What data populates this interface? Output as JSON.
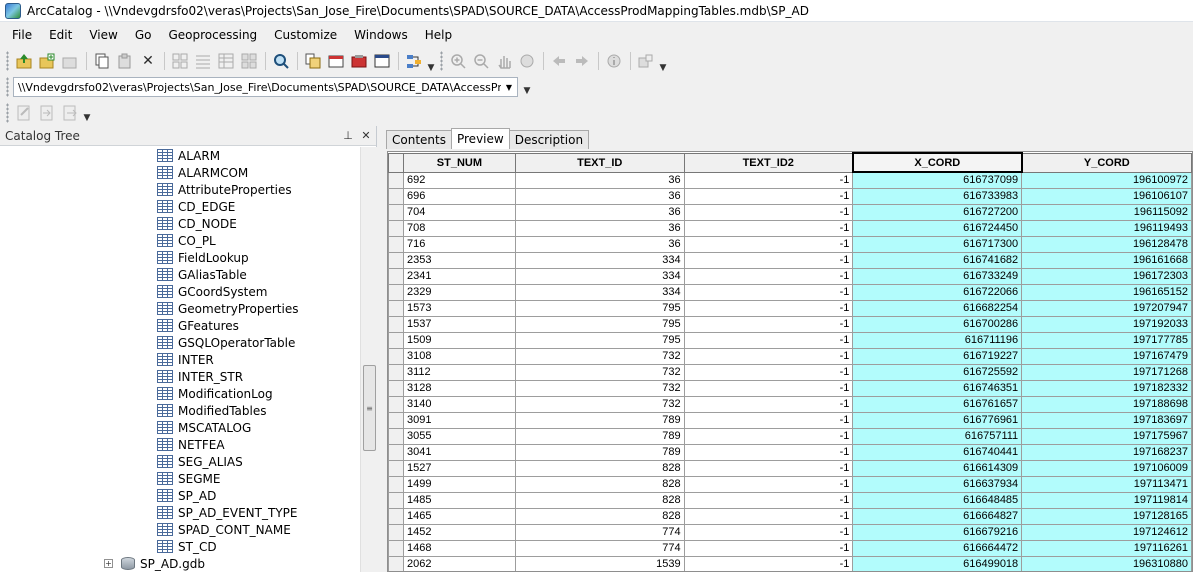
{
  "window": {
    "title": "ArcCatalog - \\\\Vndevgdrsfo02\\veras\\Projects\\San_Jose_Fire\\Documents\\SPAD\\SOURCE_DATA\\AccessProdMappingTables.mdb\\SP_AD"
  },
  "menu": [
    "File",
    "Edit",
    "View",
    "Go",
    "Geoprocessing",
    "Customize",
    "Windows",
    "Help"
  ],
  "toolbar": {
    "icons": [
      "up-folder-icon",
      "connect-folder-icon",
      "disconnect-folder-icon",
      "copy-icon",
      "paste-icon",
      "delete-icon",
      "large-icons-icon",
      "list-icon",
      "details-icon",
      "thumbnails-icon",
      "search-icon",
      "catalog-tree-icon",
      "arctoolbox-icon",
      "arcmap-icon",
      "python-icon",
      "model-icon"
    ],
    "nav_icons": [
      "zoom-in-icon",
      "zoom-out-icon",
      "pan-icon",
      "full-extent-icon",
      "back-icon",
      "forward-icon",
      "identify-icon",
      "create-thumbnail-icon"
    ]
  },
  "location": {
    "value": "\\\\Vndevgdrsfo02\\veras\\Projects\\San_Jose_Fire\\Documents\\SPAD\\SOURCE_DATA\\AccessProdM..."
  },
  "catalog_tree": {
    "title": "Catalog Tree",
    "items": [
      "ALARM",
      "ALARMCOM",
      "AttributeProperties",
      "CD_EDGE",
      "CD_NODE",
      "CO_PL",
      "FieldLookup",
      "GAliasTable",
      "GCoordSystem",
      "GeometryProperties",
      "GFeatures",
      "GSQLOperatorTable",
      "INTER",
      "INTER_STR",
      "ModificationLog",
      "ModifiedTables",
      "MSCATALOG",
      "NETFEA",
      "SEG_ALIAS",
      "SEGME",
      "SP_AD",
      "SP_AD_EVENT_TYPE",
      "SPAD_CONT_NAME",
      "ST_CD"
    ],
    "gdb_item": "SP_AD.gdb"
  },
  "tabs": [
    "Contents",
    "Preview",
    "Description"
  ],
  "active_tab": "Preview",
  "table": {
    "columns": [
      "ST_NUM",
      "TEXT_ID",
      "TEXT_ID2",
      "X_CORD",
      "Y_CORD"
    ],
    "selected_column": "X_CORD",
    "rows": [
      [
        "692",
        "36",
        "-1",
        "616737099",
        "196100972"
      ],
      [
        "696",
        "36",
        "-1",
        "616733983",
        "196106107"
      ],
      [
        "704",
        "36",
        "-1",
        "616727200",
        "196115092"
      ],
      [
        "708",
        "36",
        "-1",
        "616724450",
        "196119493"
      ],
      [
        "716",
        "36",
        "-1",
        "616717300",
        "196128478"
      ],
      [
        "2353",
        "334",
        "-1",
        "616741682",
        "196161668"
      ],
      [
        "2341",
        "334",
        "-1",
        "616733249",
        "196172303"
      ],
      [
        "2329",
        "334",
        "-1",
        "616722066",
        "196165152"
      ],
      [
        "1573",
        "795",
        "-1",
        "616682254",
        "197207947"
      ],
      [
        "1537",
        "795",
        "-1",
        "616700286",
        "197192033"
      ],
      [
        "1509",
        "795",
        "-1",
        "616711196",
        "197177785"
      ],
      [
        "3108",
        "732",
        "-1",
        "616719227",
        "197167479"
      ],
      [
        "3112",
        "732",
        "-1",
        "616725592",
        "197171268"
      ],
      [
        "3128",
        "732",
        "-1",
        "616746351",
        "197182332"
      ],
      [
        "3140",
        "732",
        "-1",
        "616761657",
        "197188698"
      ],
      [
        "3091",
        "789",
        "-1",
        "616776961",
        "197183697"
      ],
      [
        "3055",
        "789",
        "-1",
        "616757111",
        "197175967"
      ],
      [
        "3041",
        "789",
        "-1",
        "616740441",
        "197168237"
      ],
      [
        "1527",
        "828",
        "-1",
        "616614309",
        "197106009"
      ],
      [
        "1499",
        "828",
        "-1",
        "616637934",
        "197113471"
      ],
      [
        "1485",
        "828",
        "-1",
        "616648485",
        "197119814"
      ],
      [
        "1465",
        "828",
        "-1",
        "616664827",
        "197128165"
      ],
      [
        "1452",
        "774",
        "-1",
        "616679216",
        "197124612"
      ],
      [
        "1468",
        "774",
        "-1",
        "616664472",
        "197116261"
      ],
      [
        "2062",
        "1539",
        "-1",
        "616499018",
        "196310880"
      ]
    ]
  },
  "colors": {
    "selected_column": "#b2fcfc",
    "window_bg": "#f0f0f0"
  }
}
